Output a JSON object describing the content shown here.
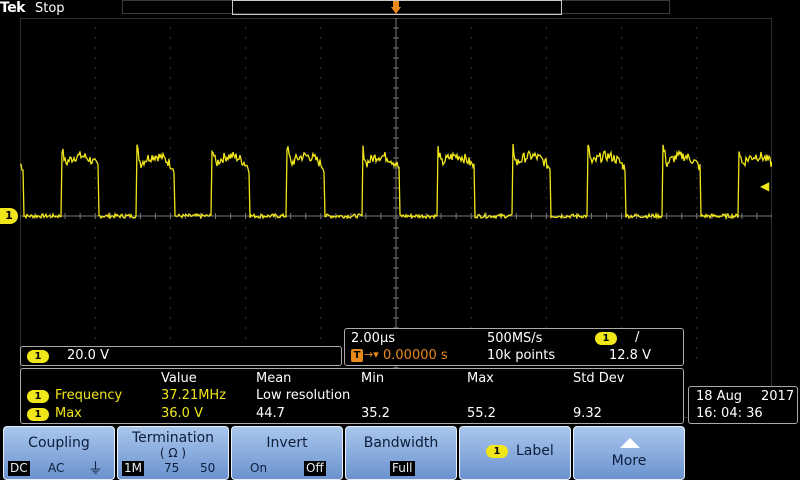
{
  "top": {
    "brand": "Tek",
    "state": "Stop"
  },
  "trigger_marker": "T",
  "channel": {
    "label": "1",
    "scale": "20.0 V",
    "color": "#f0e61a"
  },
  "horizontal": {
    "time_per_div": "2.00µs",
    "sample_rate": "500MS/s",
    "trigger_source": "1",
    "trigger_slope": "/",
    "trigger_position": "0.00000 s",
    "record_length": "10k points",
    "trigger_level": "12.8 V"
  },
  "measurements": {
    "headers": [
      "Value",
      "Mean",
      "Min",
      "Max",
      "Std Dev"
    ],
    "rows": [
      {
        "channel": "1",
        "name": "Frequency",
        "value": "37.21MHz",
        "mean": "Low resolution",
        "min": "",
        "max": "",
        "std": ""
      },
      {
        "channel": "1",
        "name": "Max",
        "value": "36.0 V",
        "mean": "44.7",
        "min": "35.2",
        "max": "55.2",
        "std": "9.32"
      }
    ]
  },
  "datetime": {
    "date_day": "18 Aug",
    "date_year": "2017",
    "time": "16: 04: 36"
  },
  "softkeys": {
    "coupling": {
      "title": "Coupling",
      "options": [
        "DC",
        "AC",
        "⏚"
      ]
    },
    "termination": {
      "title": "Termination",
      "subtitle": "( Ω )",
      "options": [
        "1M",
        "75",
        "50"
      ]
    },
    "invert": {
      "title": "Invert",
      "options": [
        "On",
        "Off"
      ]
    },
    "bandwidth": {
      "title": "Bandwidth",
      "value": "Full"
    },
    "label": {
      "channel": "1",
      "title": "Label"
    },
    "more": {
      "title": "More"
    }
  },
  "waveform": {
    "period_us": 2.0,
    "duty_fraction": 0.5,
    "high_level_v": 21.0,
    "overshoot_v": 30.0,
    "low_level_v": 0.0,
    "volts_per_div": 20.0,
    "time_per_div_us": 2.0,
    "first_rising_edge_div": 1.55
  }
}
